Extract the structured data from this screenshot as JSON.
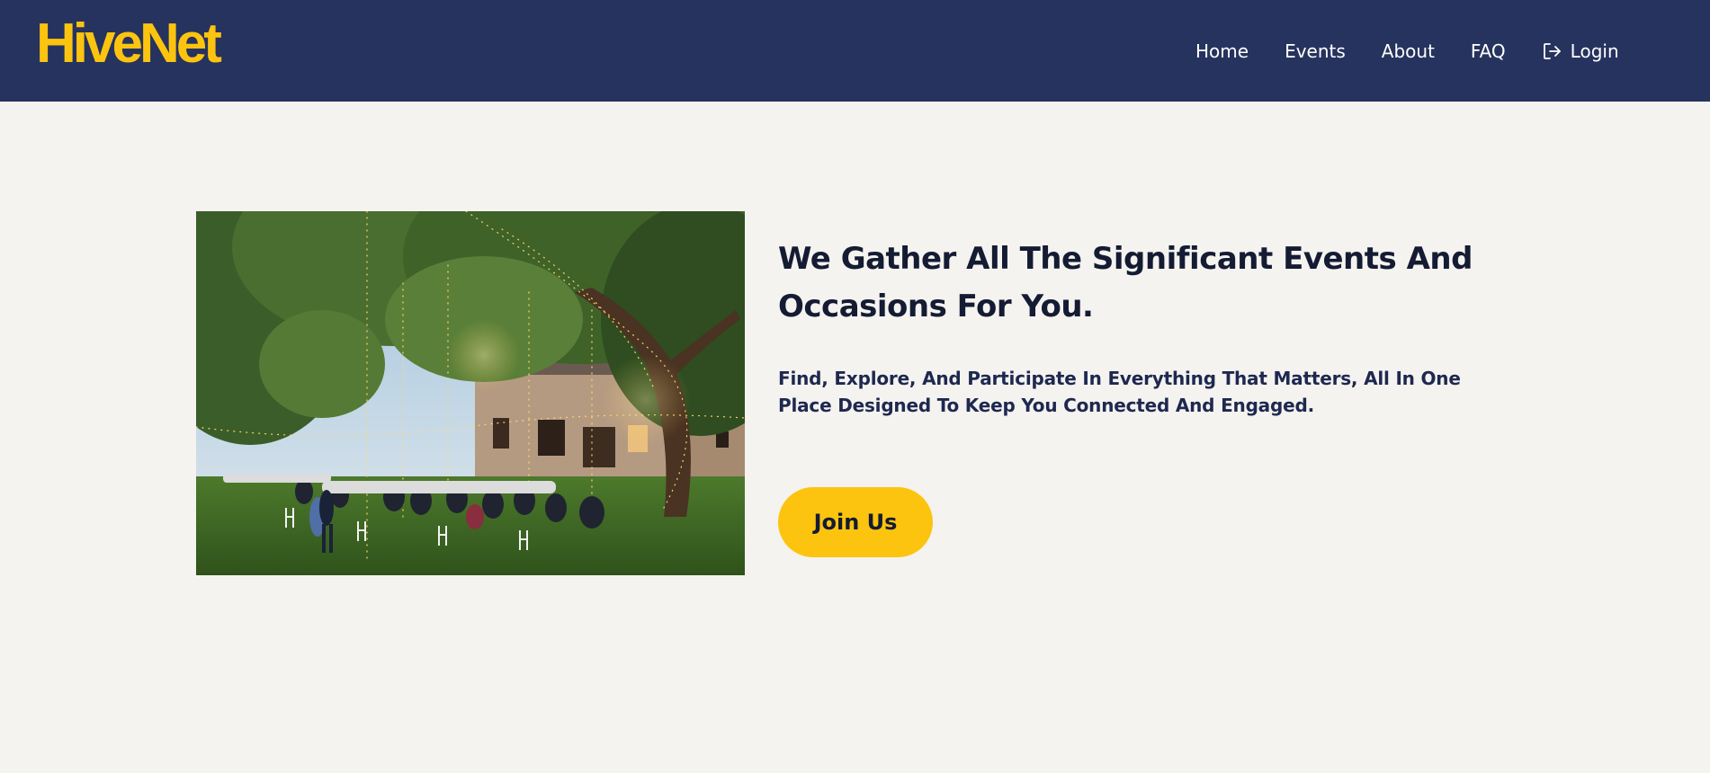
{
  "header": {
    "logo_text": "HiveNet",
    "nav": [
      {
        "label": "Home"
      },
      {
        "label": "Events"
      },
      {
        "label": "About"
      },
      {
        "label": "FAQ"
      },
      {
        "label": "Login",
        "icon": "login-icon"
      }
    ]
  },
  "hero": {
    "image": {
      "semantic": "outdoor-evening-dinner-event-photo"
    },
    "title": "We Gather All The Significant Events And Occasions For You.",
    "subtitle": "Find, Explore, And Participate In Everything That Matters, All In One Place Designed To Keep You Connected And Engaged.",
    "cta_label": "Join Us"
  },
  "colors": {
    "header_bg": "#26335e",
    "accent": "#fcc40f",
    "page_bg": "#f4f3ef",
    "heading_text": "#141b33"
  }
}
